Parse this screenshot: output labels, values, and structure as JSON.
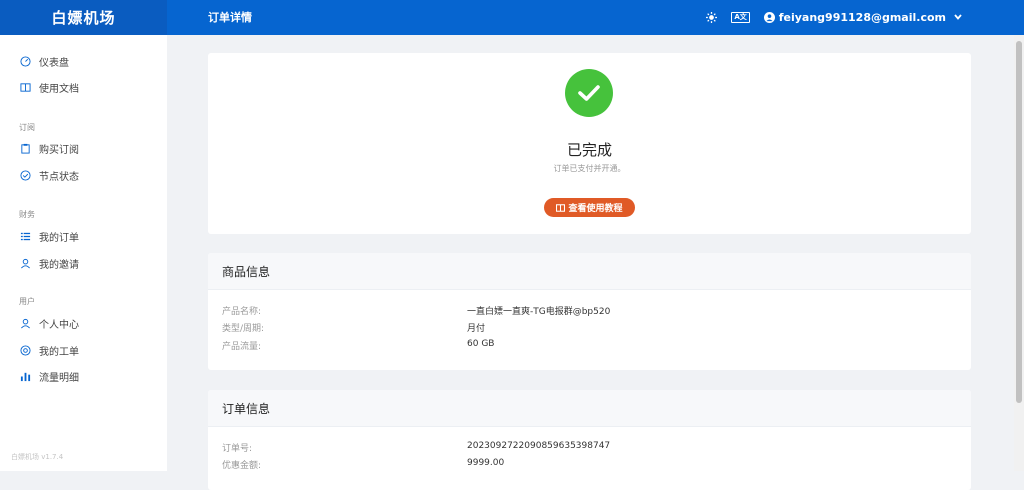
{
  "brand": "白嫖机场",
  "header": {
    "page_title": "订单详情",
    "user_email": "feiyang991128@gmail.com",
    "lang_label": "A文",
    "icons": [
      "theme-icon",
      "translate-icon",
      "user-icon",
      "chevron-down-icon"
    ]
  },
  "sidebar": {
    "items": [
      {
        "label": "仪表盘",
        "icon": "dashboard-icon"
      },
      {
        "label": "使用文档",
        "icon": "book-icon"
      }
    ],
    "sections": [
      {
        "title": "订阅",
        "items": [
          {
            "label": "购买订阅",
            "icon": "clipboard-icon"
          },
          {
            "label": "节点状态",
            "icon": "check-circle-icon"
          }
        ]
      },
      {
        "title": "财务",
        "items": [
          {
            "label": "我的订单",
            "icon": "list-icon"
          },
          {
            "label": "我的邀请",
            "icon": "users-icon"
          }
        ]
      },
      {
        "title": "用户",
        "items": [
          {
            "label": "个人中心",
            "icon": "user-icon"
          },
          {
            "label": "我的工单",
            "icon": "support-icon"
          },
          {
            "label": "流量明细",
            "icon": "bar-chart-icon"
          }
        ]
      }
    ],
    "version": "白嫖机场 v1.7.4"
  },
  "status": {
    "title": "已完成",
    "subtitle": "订单已支付并开通。",
    "button_label": "查看使用教程"
  },
  "product_info": {
    "title": "商品信息",
    "rows": [
      {
        "key": "产品名称:",
        "value": "一直白嫖一直爽-TG电报群@bp520"
      },
      {
        "key": "类型/周期:",
        "value": "月付"
      },
      {
        "key": "产品流量:",
        "value": "60 GB"
      }
    ]
  },
  "order_info": {
    "title": "订单信息",
    "rows": [
      {
        "key": "订单号:",
        "value": "2023092722090859635398747"
      },
      {
        "key": "优惠金额:",
        "value": "9999.00"
      }
    ]
  },
  "colors": {
    "header": "#0665d0",
    "success": "#46c23c",
    "button": "#e05a26"
  }
}
